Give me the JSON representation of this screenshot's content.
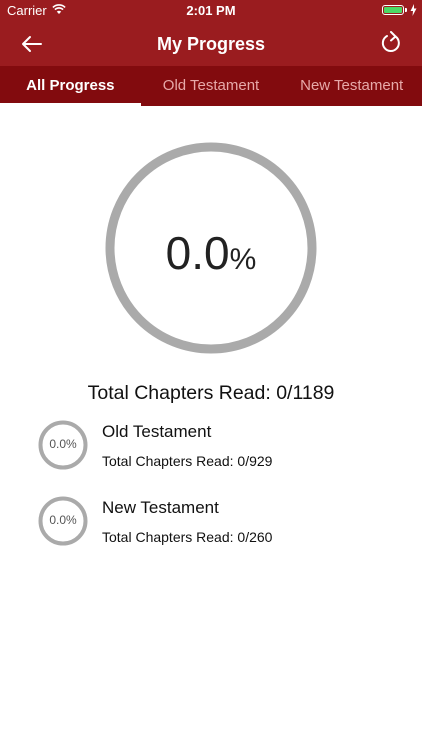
{
  "status_bar": {
    "carrier": "Carrier",
    "time": "2:01 PM"
  },
  "nav": {
    "title": "My Progress",
    "back_icon": "back-arrow-icon",
    "refresh_icon": "refresh-icon"
  },
  "tabs": [
    {
      "label": "All Progress",
      "active": true
    },
    {
      "label": "Old Testament",
      "active": false
    },
    {
      "label": "New Testament",
      "active": false
    }
  ],
  "overall": {
    "percent_value": "0.0",
    "percent_sign": "%",
    "progress": 0.0,
    "total_label": "Total Chapters Read: 0/1189"
  },
  "sections": [
    {
      "name": "Old Testament",
      "percent": "0.0%",
      "progress": 0.0,
      "total_label": "Total Chapters Read: 0/929"
    },
    {
      "name": "New Testament",
      "percent": "0.0%",
      "progress": 0.0,
      "total_label": "Total Chapters Read: 0/260"
    }
  ],
  "colors": {
    "primary": "#9a1c1f",
    "tab_bar": "#820b0e",
    "ring": "#aaaaaa",
    "battery": "#4cd964"
  }
}
